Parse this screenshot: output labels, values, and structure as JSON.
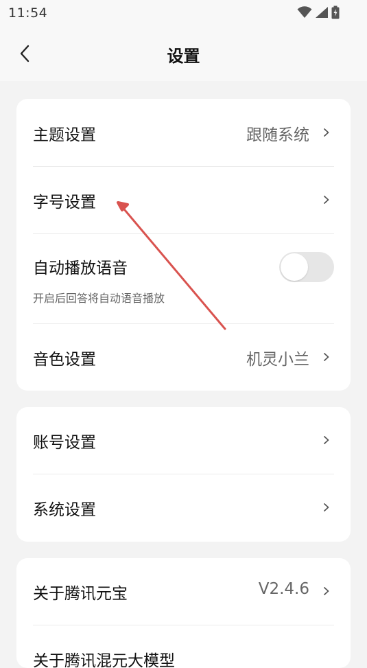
{
  "status_bar": {
    "time": "11:54"
  },
  "header": {
    "title": "设置"
  },
  "card1": {
    "theme": {
      "label": "主题设置",
      "value": "跟随系统"
    },
    "font_size": {
      "label": "字号设置"
    },
    "auto_play": {
      "label": "自动播放语音",
      "subtitle": "开启后回答将自动语音播放",
      "enabled": false
    },
    "voice": {
      "label": "音色设置",
      "value": "机灵小兰"
    }
  },
  "card2": {
    "account": {
      "label": "账号设置"
    },
    "system": {
      "label": "系统设置"
    }
  },
  "card3": {
    "about": {
      "label": "关于腾讯元宝",
      "value": "V2.4.6"
    },
    "about_model": {
      "label": "关于腾讯混元大模型"
    }
  },
  "colors": {
    "annotation_arrow": "#d9534f"
  }
}
